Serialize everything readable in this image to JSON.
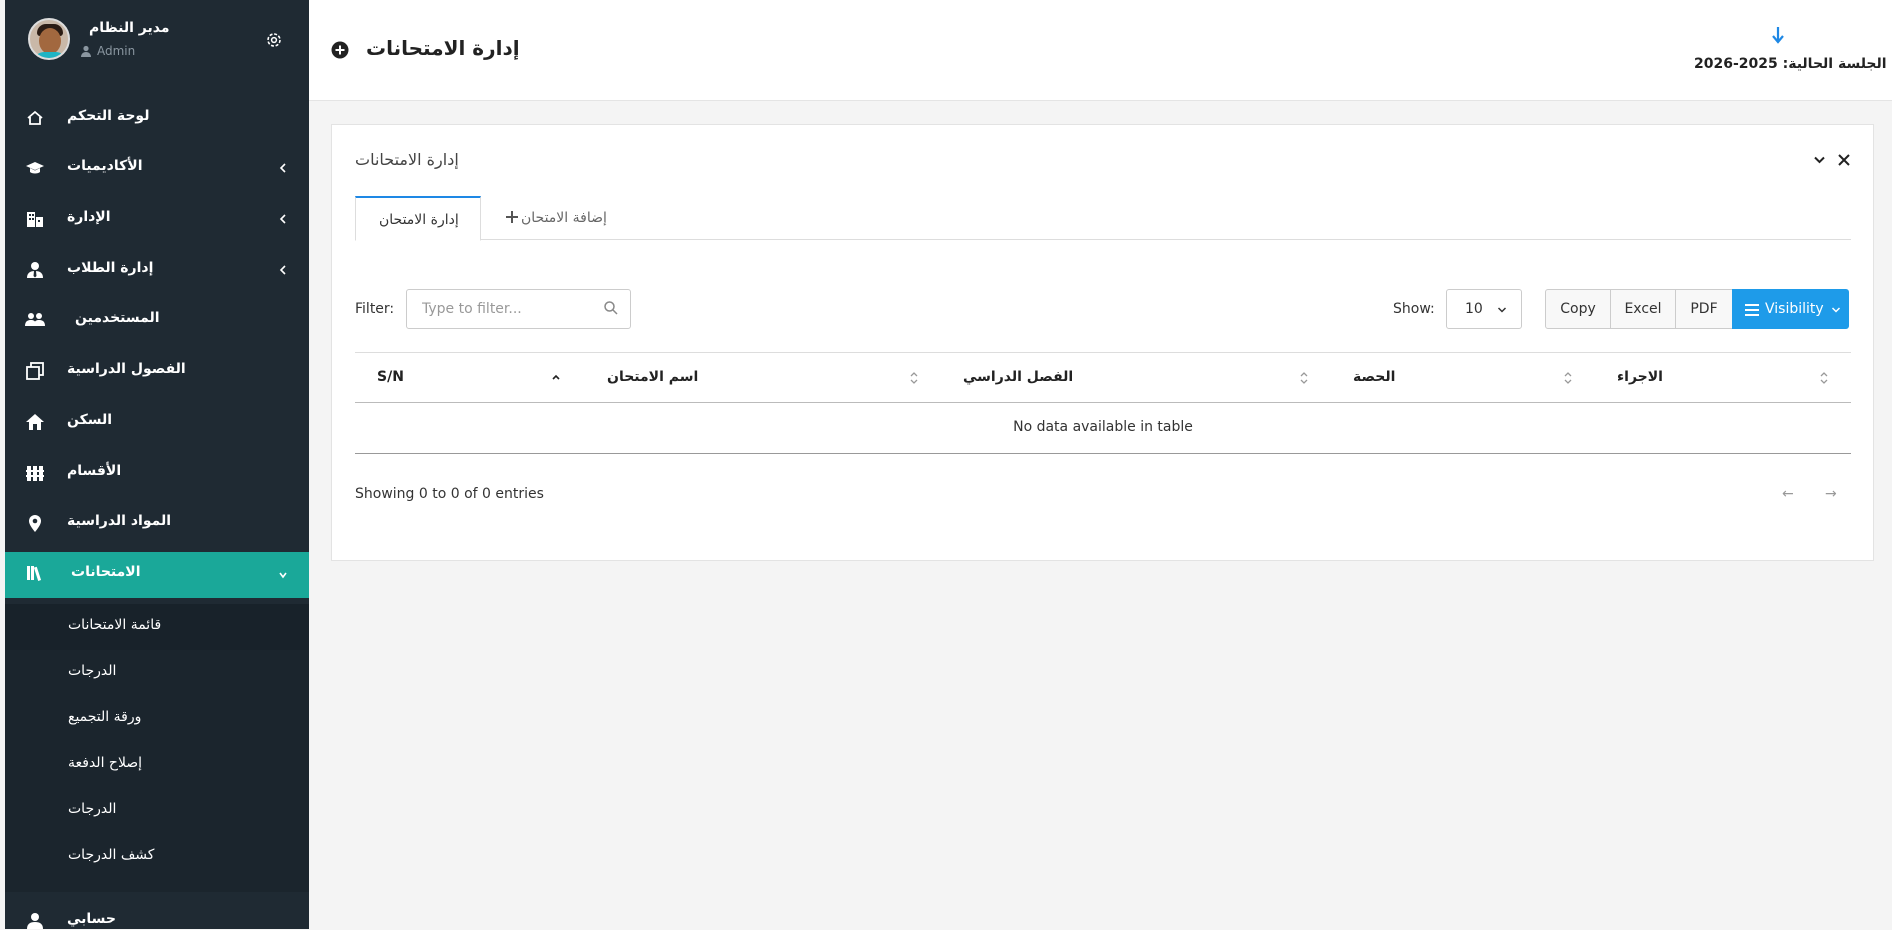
{
  "user": {
    "name": "مدير النظام",
    "role": "Admin"
  },
  "sidebar": {
    "items": [
      {
        "label": "لوحة التحكم",
        "icon": "home-icon"
      },
      {
        "label": "الأكاديميات",
        "icon": "graduation-cap-icon",
        "has_children": true
      },
      {
        "label": "الإدارة",
        "icon": "building-icon",
        "has_children": true
      },
      {
        "label": "إدارة الطلاب",
        "icon": "user-tie-icon",
        "has_children": true
      },
      {
        "label": "المستخدمين",
        "icon": "users-icon"
      },
      {
        "label": "الفصول الدراسية",
        "icon": "clone-icon"
      },
      {
        "label": "السكن",
        "icon": "house-icon"
      },
      {
        "label": "الأقسام",
        "icon": "fence-icon"
      },
      {
        "label": "المواد الدراسية",
        "icon": "map-pin-icon"
      },
      {
        "label": "الامتحانات",
        "icon": "books-icon",
        "has_children": true,
        "active": true
      }
    ],
    "submenu": [
      {
        "label": "قائمة الامتحانات",
        "current": true
      },
      {
        "label": "الدرجات"
      },
      {
        "label": "ورقة التجميع"
      },
      {
        "label": "إصلاح الدفعة"
      },
      {
        "label": "الدرجات"
      },
      {
        "label": "كشف الدرجات"
      }
    ],
    "after": {
      "label": "حسابي",
      "icon": "user-icon"
    },
    "active_color": "#1aa899",
    "bg_color": "#1f2a33"
  },
  "header": {
    "title": "إدارة الامتحانات",
    "session": "الجلسة الحالية: 2025-2026"
  },
  "panel": {
    "title": "إدارة الامتحانات",
    "tabs": [
      {
        "label": "إدارة الامتحان",
        "active": true
      },
      {
        "label": "إضافة الامتحان",
        "icon": "plus-icon"
      }
    ]
  },
  "table_controls": {
    "filter_label": "Filter:",
    "filter_placeholder": "Type to filter...",
    "show_label": "Show:",
    "show_value": "10",
    "buttons": [
      "Copy",
      "Excel",
      "PDF",
      "Visibility"
    ],
    "accent": "#1e9be9"
  },
  "table": {
    "columns": [
      "S/N",
      "اسم الامتحان",
      "الفصل الدراسي",
      "الحصة",
      "الاجراء"
    ],
    "empty_text": "No data available in table",
    "info": "Showing 0 to 0 of 0 entries",
    "prev": "←",
    "next": "→"
  }
}
